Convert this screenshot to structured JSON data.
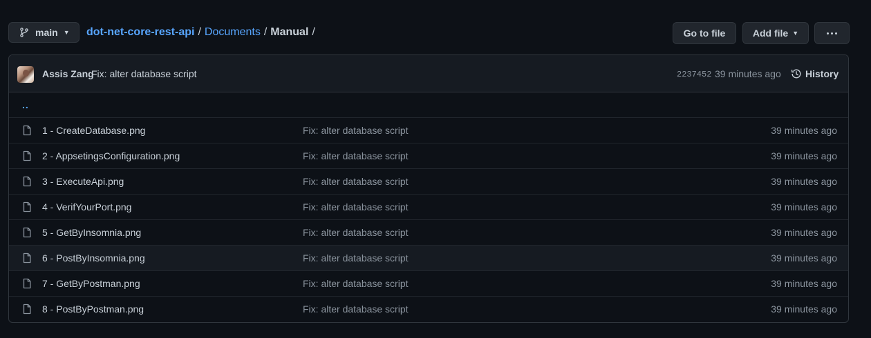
{
  "branch": {
    "name": "main"
  },
  "breadcrumb": {
    "repo": "dot-net-core-rest-api",
    "separator": "/",
    "folder": "Documents",
    "current": "Manual"
  },
  "actions": {
    "go_to_file": "Go to file",
    "add_file": "Add file"
  },
  "commit": {
    "author": "Assis Zang",
    "message": "Fix: alter database script",
    "sha": "2237452",
    "time": "39 minutes ago",
    "history_label": "History"
  },
  "parent_dir": "..",
  "files": [
    {
      "name": "1 - CreateDatabase.png",
      "message": "Fix: alter database script",
      "time": "39 minutes ago"
    },
    {
      "name": "2 - AppsetingsConfiguration.png",
      "message": "Fix: alter database script",
      "time": "39 minutes ago"
    },
    {
      "name": "3 - ExecuteApi.png",
      "message": "Fix: alter database script",
      "time": "39 minutes ago"
    },
    {
      "name": "4 - VerifYourPort.png",
      "message": "Fix: alter database script",
      "time": "39 minutes ago"
    },
    {
      "name": "5 - GetByInsomnia.png",
      "message": "Fix: alter database script",
      "time": "39 minutes ago"
    },
    {
      "name": "6 - PostByInsomnia.png",
      "message": "Fix: alter database script",
      "time": "39 minutes ago"
    },
    {
      "name": "7 - GetByPostman.png",
      "message": "Fix: alter database script",
      "time": "39 minutes ago"
    },
    {
      "name": "8 - PostByPostman.png",
      "message": "Fix: alter database script",
      "time": "39 minutes ago"
    }
  ],
  "colors": {
    "background": "#0d1117",
    "link": "#58a6ff",
    "muted": "#8b949e",
    "border": "#30363d"
  }
}
